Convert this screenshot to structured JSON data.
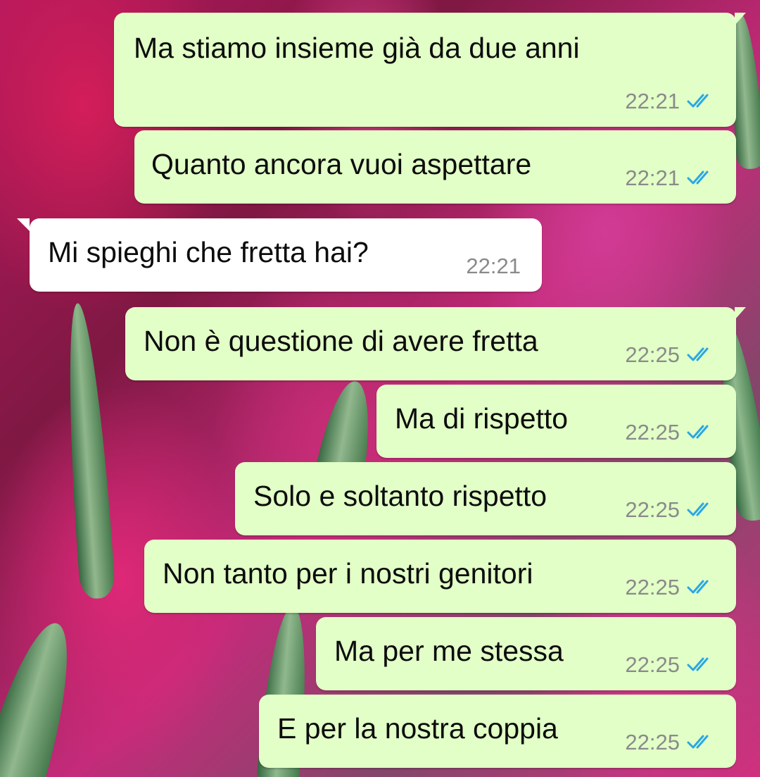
{
  "messages": [
    {
      "text": "Ma stiamo insieme già da due anni",
      "time": "22:21",
      "direction": "out",
      "status": "read",
      "status_icon": "double-check-icon"
    },
    {
      "text": "Quanto ancora vuoi aspettare",
      "time": "22:21",
      "direction": "out",
      "status": "read",
      "status_icon": "double-check-icon"
    },
    {
      "text": "Mi spieghi che fretta hai?",
      "time": "22:21",
      "direction": "in"
    },
    {
      "text": "Non è questione di avere fretta",
      "time": "22:25",
      "direction": "out",
      "status": "read",
      "status_icon": "double-check-icon"
    },
    {
      "text": "Ma di rispetto",
      "time": "22:25",
      "direction": "out",
      "status": "read",
      "status_icon": "double-check-icon"
    },
    {
      "text": "Solo e soltanto rispetto",
      "time": "22:25",
      "direction": "out",
      "status": "read",
      "status_icon": "double-check-icon"
    },
    {
      "text": "Non tanto per i nostri genitori",
      "time": "22:25",
      "direction": "out",
      "status": "read",
      "status_icon": "double-check-icon"
    },
    {
      "text": "Ma per me stessa",
      "time": "22:25",
      "direction": "out",
      "status": "read",
      "status_icon": "double-check-icon"
    },
    {
      "text": "E per la nostra coppia",
      "time": "22:25",
      "direction": "out",
      "status": "read",
      "status_icon": "double-check-icon"
    }
  ],
  "colors": {
    "outgoing_bubble": "#e2ffc7",
    "incoming_bubble": "#ffffff",
    "read_ticks": "#2aa7e4",
    "timestamp": "#8a8a8a"
  },
  "wallpaper": "pink tulips with green leaves"
}
